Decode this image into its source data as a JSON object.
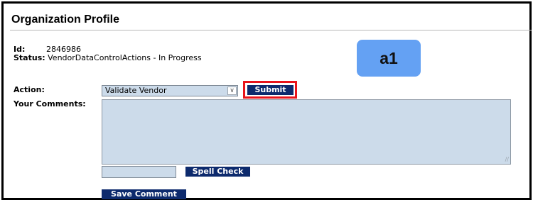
{
  "page": {
    "title": "Organization Profile"
  },
  "record": {
    "id_label": "Id:",
    "id_value": "2846986",
    "status_label": "Status:",
    "status_value": "VendorDataControlActions - In Progress"
  },
  "form": {
    "action_label": "Action:",
    "action_selected": "Validate Vendor",
    "submit_label": "Submit",
    "comments_label": "Your Comments:",
    "comments_value": "",
    "spell_check_value": "",
    "spell_check_label": "Spell Check",
    "save_comment_label": "Save Comment"
  },
  "annotation": {
    "badge_text": "a1",
    "badge_color": "#64a1f3",
    "highlight_color": "#e8141b"
  },
  "colors": {
    "button_bg": "#0d2a6d",
    "field_bg": "#ccdbea"
  }
}
